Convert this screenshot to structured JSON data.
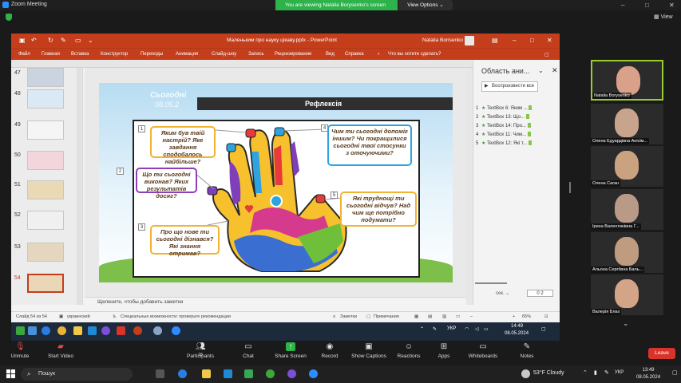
{
  "zoom": {
    "title": "Zoom Meeting",
    "banner": "You are viewing Natalia Borysenko's screen",
    "view_options": "View Options",
    "view_label": "View",
    "controls": {
      "unmute": "Unmute",
      "start_video": "Start Video",
      "participants": "Participants",
      "participants_count": "18",
      "chat": "Chat",
      "share_screen": "Share Screen",
      "record": "Record",
      "show_captions": "Show Captions",
      "reactions": "Reactions",
      "apps": "Apps",
      "whiteboards": "Whiteboards",
      "notes": "Notes",
      "leave": "Leave"
    },
    "participants": [
      {
        "name": "Natalia Borysenko",
        "active": true,
        "face": "#d9a18a"
      },
      {
        "name": "Олена Едуардівна Анісім...",
        "active": false,
        "face": "#c9a48c"
      },
      {
        "name": "Олена Саган",
        "active": false,
        "face": "#caa27f"
      },
      {
        "name": "Ірина Валентинівна Г...",
        "active": false,
        "face": "#b89a86"
      },
      {
        "name": "Альона Сергіївна Баль...",
        "active": false,
        "face": "#bf9b7f"
      },
      {
        "name": "Валерія Блах",
        "active": false,
        "face": "#d4a487"
      }
    ]
  },
  "ppt": {
    "doc_title": "Маленьким про науку цікаву.pptx - PowerPoint",
    "user": "Natalia Borisenko",
    "menu": [
      "Файл",
      "Главная",
      "Вставка",
      "Конструктор",
      "Переходы",
      "Анимация",
      "Слайд-шоу",
      "Запись",
      "Рецензирование",
      "Вид",
      "Справка",
      "Что вы хотите сделать?"
    ],
    "thumbs": [
      "47",
      "48",
      "49",
      "50",
      "51",
      "52",
      "53",
      "54"
    ],
    "notes_placeholder": "Щелкните, чтобы добавить заметки",
    "status": {
      "slide": "Слайд 54 из 54",
      "lang": "украинский",
      "accessibility": "Специальные возможности: проверьте рекомендации",
      "notes": "Заметки",
      "comments": "Примечания",
      "zoom": "65%"
    },
    "anim_pane": {
      "title": "Область ани...",
      "play_all": "Воспроизвести все",
      "items": [
        {
          "n": "1",
          "label": "TextBox 6: Яким ..."
        },
        {
          "n": "2",
          "label": "TextBox 13: Що..."
        },
        {
          "n": "3",
          "label": "TextBox 14: Про..."
        },
        {
          "n": "4",
          "label": "TextBox 11: Чим..."
        },
        {
          "n": "5",
          "label": "TextBox 12: Які т..."
        }
      ],
      "sec": "сек.",
      "page_a": "0",
      "page_b": "2"
    },
    "slide": {
      "title": "Рефлексія",
      "date1": "Сьогодні",
      "date2": "08.05.2",
      "bubbles": [
        {
          "num": "1",
          "text": "Яким був твій настрій? Яке завдання сподобалось найбільше?"
        },
        {
          "num": "2",
          "text": "Що ти сьогодні виконав? Яких результатів досяг?"
        },
        {
          "num": "3",
          "text": "Про що нове ти сьогодні дізнався? Які знання отримав?"
        },
        {
          "num": "4",
          "text": "Чим ти сьогодні допоміг іншим? Чи покращилися сьогодні твої стосунки з оточуючими?"
        },
        {
          "num": "5",
          "text": "Які труднощі ти сьогодні відчув? Над чим ще потрібно подумати?"
        }
      ]
    },
    "inner_taskbar": {
      "lang": "УКР",
      "time": "14:49",
      "date": "08.05.2024"
    }
  },
  "taskbar": {
    "search": "Пошук",
    "weather": "53°F  Cloudy",
    "lang": "УКР",
    "time": "13:49",
    "date": "08.05.2024"
  },
  "colors": {
    "ppt_red": "#c43e1c",
    "zoom_green": "#2db34a",
    "leave_red": "#d9342b"
  }
}
